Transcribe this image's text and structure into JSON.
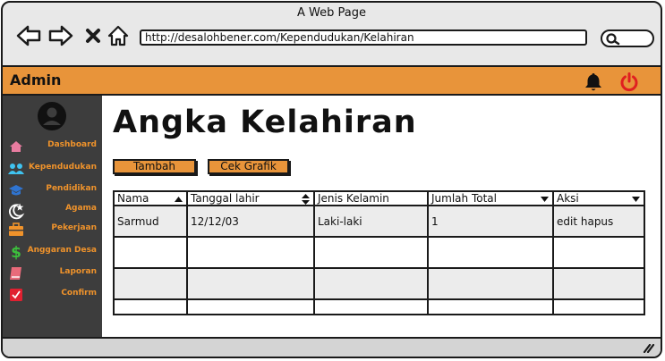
{
  "window": {
    "title": "A Web Page"
  },
  "browser": {
    "url": "http://desalohbener.com/Kependudukan/Kelahiran",
    "back_icon": "arrow-left-icon",
    "forward_icon": "arrow-right-icon",
    "stop_icon": "close-icon",
    "home_icon": "home-icon",
    "search_icon": "search-icon"
  },
  "topbar": {
    "title": "Admin",
    "accent": "#e8943a",
    "power_color": "#e02020"
  },
  "sidebar": {
    "label_color": "#f0932b",
    "items": [
      {
        "label": "Dashboard",
        "icon": "home-icon"
      },
      {
        "label": "Kependudukan",
        "icon": "users-icon"
      },
      {
        "label": "Pendidikan",
        "icon": "graduation-cap-icon"
      },
      {
        "label": "Agama",
        "icon": "moon-star-icon"
      },
      {
        "label": "Pekerjaan",
        "icon": "briefcase-icon"
      },
      {
        "label": "Anggaran Desa",
        "icon": "dollar-icon"
      },
      {
        "label": "Laporan",
        "icon": "book-icon"
      },
      {
        "label": "Confirm",
        "icon": "checkbox-icon"
      }
    ]
  },
  "main": {
    "title": "Angka Kelahiran",
    "buttons": {
      "add": "Tambah",
      "chart": "Cek Grafik"
    },
    "table": {
      "columns": [
        "Nama",
        "Tanggal lahir",
        "Jenis Kelamin",
        "Jumlah Total",
        "Aksi"
      ],
      "rows": [
        [
          "Sarmud",
          "12/12/03",
          "Laki-laki",
          "1",
          "edit hapus"
        ],
        [
          "",
          "",
          "",
          "",
          ""
        ],
        [
          "",
          "",
          "",
          "",
          ""
        ],
        [
          "",
          "",
          "",
          "",
          ""
        ]
      ]
    }
  }
}
